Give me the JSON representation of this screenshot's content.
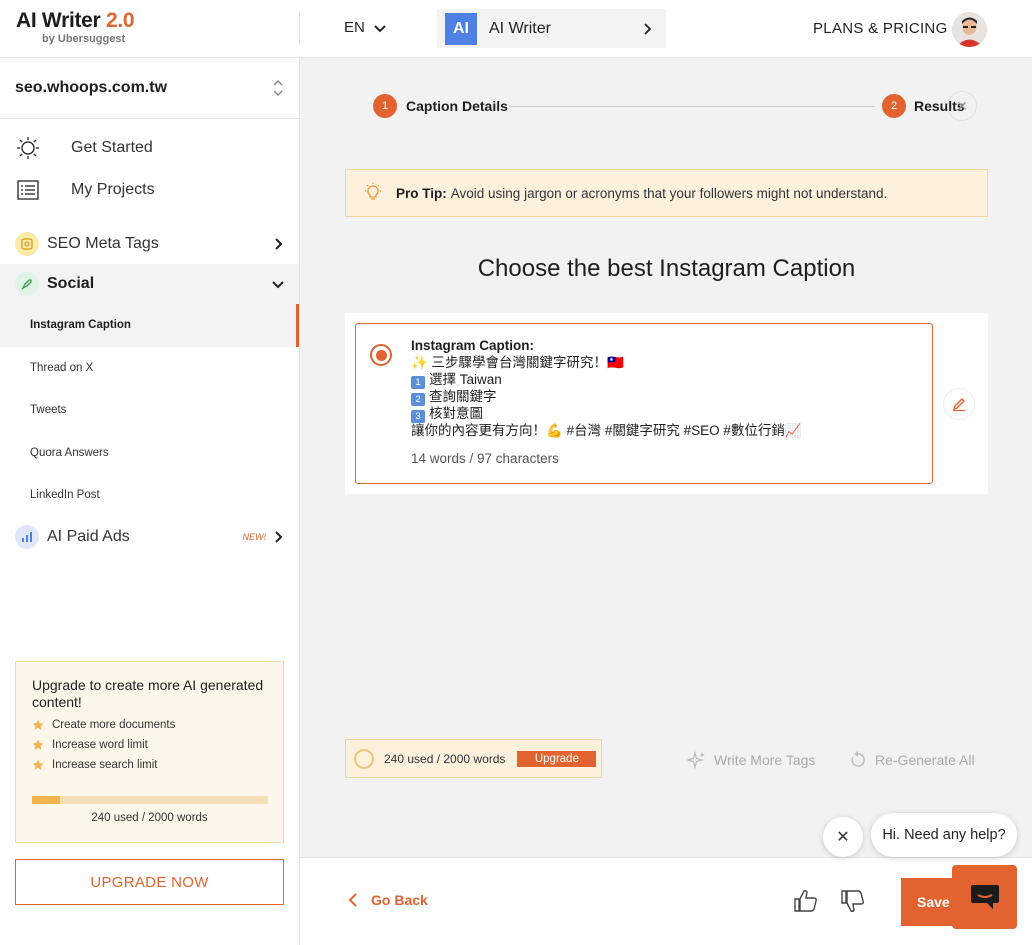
{
  "header": {
    "logo_title": "AI Writer",
    "logo_version": "2.0",
    "logo_sub": "by Ubersuggest",
    "language": "EN",
    "app_badge": "AI",
    "app_name": "AI Writer",
    "plans_label": "PLANS & PRICING"
  },
  "sidebar": {
    "site": "seo.whoops.com.tw",
    "nav": [
      {
        "label": "Get Started",
        "icon": "sun-icon"
      },
      {
        "label": "My Projects",
        "icon": "list-icon"
      }
    ],
    "categories": {
      "seo": {
        "label": "SEO Meta Tags",
        "icon": "tag-icon"
      },
      "social": {
        "label": "Social",
        "icon": "rocket-icon"
      },
      "ads": {
        "label": "AI Paid Ads",
        "icon": "chart-icon",
        "badge": "NEW!"
      }
    },
    "social_items": [
      "Instagram Caption",
      "Thread on X",
      "Tweets",
      "Quora Answers",
      "LinkedIn Post"
    ],
    "upgrade_card": {
      "title": "Upgrade to create more AI generated content!",
      "perks": [
        "Create more documents",
        "Increase word limit",
        "Increase search limit"
      ],
      "usage_label": "240 used / 2000 words",
      "usage_fraction": 0.12
    },
    "upgrade_button": "UPGRADE NOW"
  },
  "stepper": {
    "step1_num": "1",
    "step1_label": "Caption Details",
    "step2_num": "2",
    "step2_label": "Results"
  },
  "protip": {
    "label": "Pro Tip:",
    "text": "Avoid using jargon or acronyms that your followers might not understand."
  },
  "main": {
    "title": "Choose the best Instagram Caption",
    "caption": {
      "heading": "Instagram Caption:",
      "line1": "✨ 三步驟學會台灣關鍵字研究！🇹🇼",
      "line2": "選擇 Taiwan",
      "line3": "查詢關鍵字",
      "line4": "核對意圖",
      "line5": "讓你的內容更有方向！💪 #台灣 #關鍵字研究 #SEO #數位行銷📈",
      "count": "14 words / 97 characters"
    }
  },
  "usage_pill": {
    "text": "240 used / 2000 words",
    "button": "Upgrade"
  },
  "actions": {
    "write_more": "Write More Tags",
    "regenerate": "Re-Generate All"
  },
  "footer": {
    "go_back": "Go Back",
    "save": "Save"
  },
  "chat": {
    "greeting": "Hi. Need any help?"
  },
  "colors": {
    "accent": "#e2632f",
    "tip_bg": "#fdf1dd",
    "ai_badge": "#4e7fe3"
  }
}
